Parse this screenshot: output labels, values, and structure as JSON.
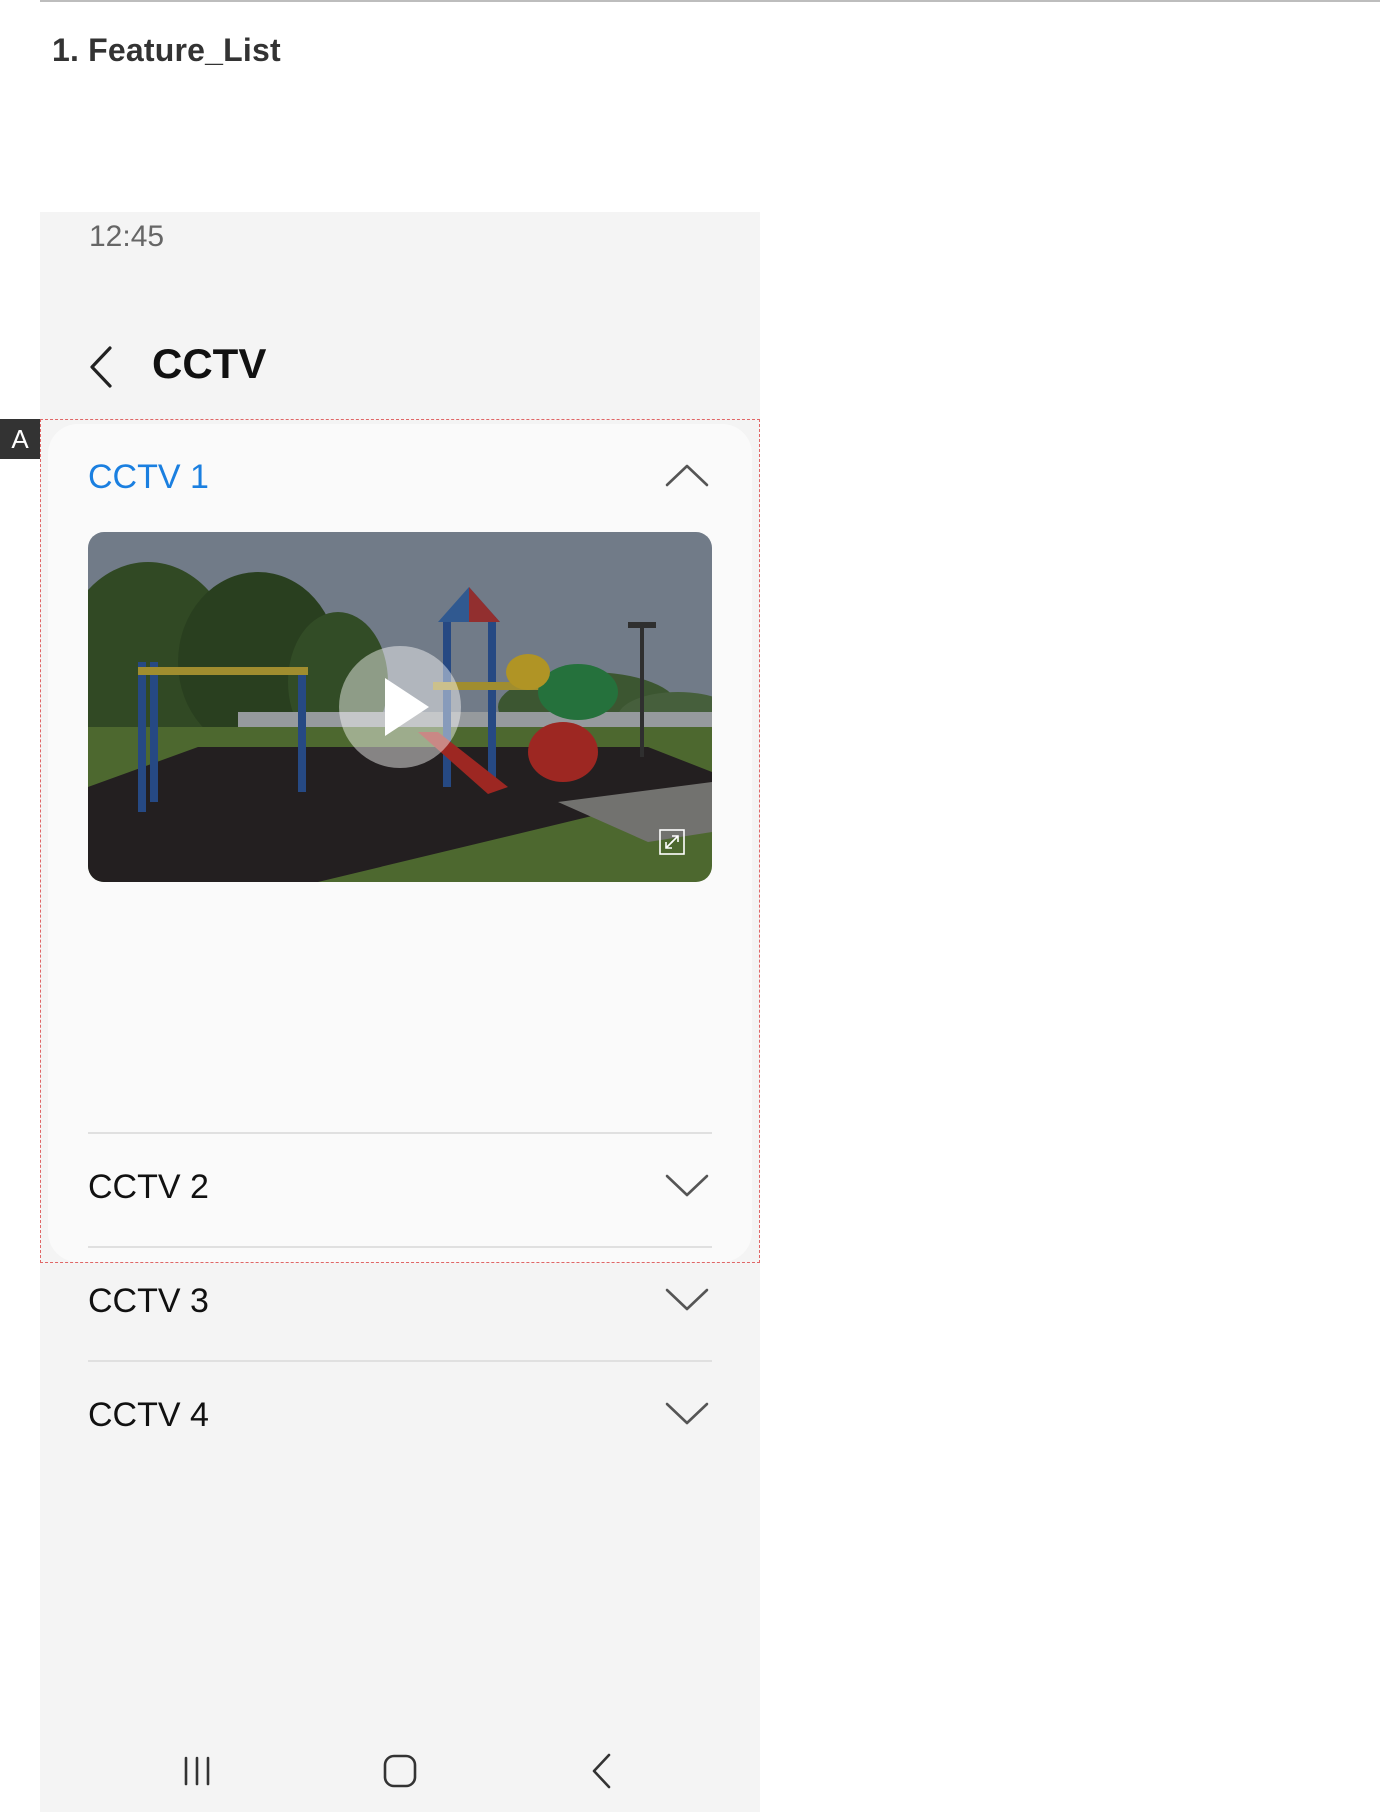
{
  "doc": {
    "title": "1. Feature_List",
    "annotation_label": "A"
  },
  "status_bar": {
    "time": "12:45"
  },
  "header": {
    "title": "CCTV",
    "back_icon": "chevron-left-icon"
  },
  "cctv_list": {
    "items": [
      {
        "label": "CCTV 1",
        "expanded": true
      },
      {
        "label": "CCTV 2",
        "expanded": false
      },
      {
        "label": "CCTV 3",
        "expanded": false
      },
      {
        "label": "CCTV 4",
        "expanded": false
      }
    ],
    "video": {
      "play_icon": "play-icon",
      "expand_icon": "fullscreen-icon"
    }
  },
  "navbar": {
    "recents_icon": "recents-icon",
    "home_icon": "home-icon",
    "back_icon": "back-icon"
  },
  "colors": {
    "accent": "#1a7fe0",
    "background": "#f4f4f4",
    "card": "#fafafa"
  }
}
